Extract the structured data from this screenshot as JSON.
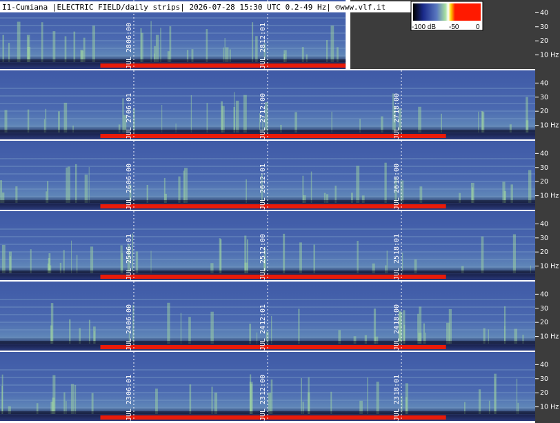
{
  "header": {
    "title": "I1-Cumiana |ELECTRIC FIELD/daily strips| 2026-07-28 15:30 UTC 0.2-49 Hz| ©www.vlf.it"
  },
  "legend": {
    "min_label": "-100 dB",
    "mid_label": "-50",
    "max_label": "0",
    "colors": [
      "#000000",
      "#1a2a8a",
      "#5a78c0",
      "#a8e0a0",
      "#ffffff",
      "#ffd000",
      "#ff1a00"
    ]
  },
  "chart_data": {
    "type": "heatmap",
    "title": "I1-Cumiana |ELECTRIC FIELD/daily strips| 2026-07-28 15:30 UTC 0.2-49 Hz| ©www.vlf.it",
    "xlabel": "",
    "ylabel": "",
    "y_range_hz": [
      0.2,
      49
    ],
    "y_ticks": [
      "40",
      "30",
      "20",
      "10 Hz"
    ],
    "strips": [
      {
        "date_label": "JUL 28",
        "time_labels": [
          "06:00",
          "12:01"
        ],
        "coverage_end_hour": 15.5
      },
      {
        "date_label": "JUL 27",
        "time_labels": [
          "06:01",
          "12:00",
          "18:00"
        ],
        "coverage_end_hour": 24
      },
      {
        "date_label": "JUL 26",
        "time_labels": [
          "06:00",
          "12:01",
          "18:00"
        ],
        "coverage_end_hour": 24
      },
      {
        "date_label": "JUL 25",
        "time_labels": [
          "06:01",
          "12:00",
          "18:01"
        ],
        "coverage_end_hour": 24
      },
      {
        "date_label": "JUL 24",
        "time_labels": [
          "06:00",
          "12:01",
          "18:00"
        ],
        "coverage_end_hour": 24
      },
      {
        "date_label": "JUL 23",
        "time_labels": [
          "06:01",
          "12:00",
          "18:01"
        ],
        "coverage_end_hour": 24
      }
    ],
    "marker_hours": [
      6,
      12,
      18
    ],
    "color_scale_db": [
      -100,
      0
    ]
  }
}
